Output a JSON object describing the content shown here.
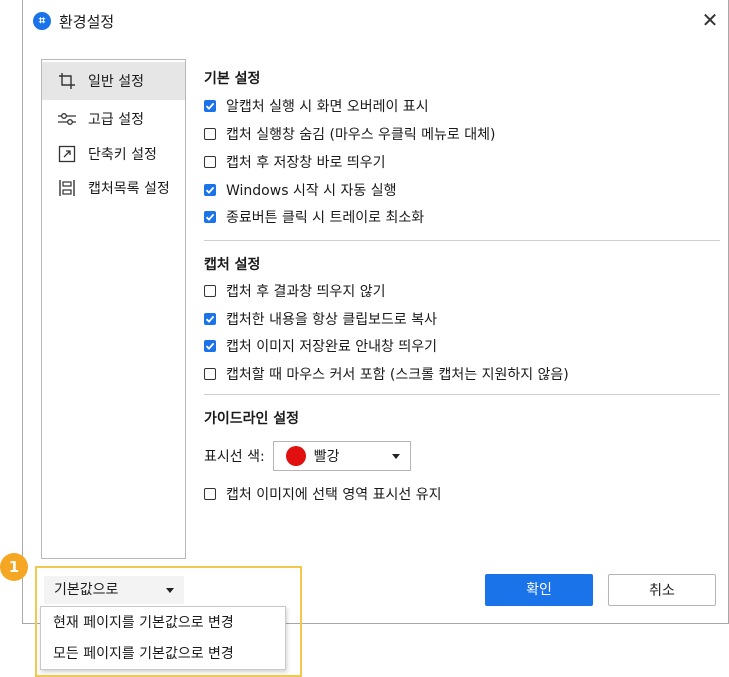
{
  "window": {
    "title": "환경설정",
    "app_icon": "capture-app-icon",
    "close_glyph": "✕"
  },
  "sidebar": {
    "items": [
      {
        "label": "일반 설정",
        "icon": "crop-icon",
        "active": true
      },
      {
        "label": "고급 설정",
        "icon": "sliders-icon",
        "active": false
      },
      {
        "label": "단축키 설정",
        "icon": "shortcut-arrow-icon",
        "active": false
      },
      {
        "label": "캡처목록 설정",
        "icon": "capture-list-icon",
        "active": false
      }
    ]
  },
  "basic": {
    "title": "기본 설정",
    "options": [
      {
        "label": "알캡처 실행 시 화면 오버레이 표시",
        "checked": true
      },
      {
        "label": "캡처 실행창 숨김 (마우스 우클릭 메뉴로 대체)",
        "checked": false
      },
      {
        "label": "캡처 후 저장창 바로 띄우기",
        "checked": false
      },
      {
        "label": "Windows 시작 시 자동 실행",
        "checked": true
      },
      {
        "label": "종료버튼 클릭 시 트레이로 최소화",
        "checked": true
      }
    ]
  },
  "capture": {
    "title": "캡처 설정",
    "options": [
      {
        "label": "캡처 후 결과창 띄우지 않기",
        "checked": false
      },
      {
        "label": "캡처한 내용을 항상 클립보드로 복사",
        "checked": true
      },
      {
        "label": "캡처 이미지 저장완료 안내창 띄우기",
        "checked": true
      },
      {
        "label": "캡처할 때 마우스 커서 포함 (스크롤 캡처는 지원하지 않음)",
        "checked": false
      }
    ]
  },
  "guide": {
    "title": "가이드라인 설정",
    "color_label": "표시선 색:",
    "color_value": "빨강",
    "color_hex": "#e01010",
    "keep_option": {
      "label": "캡처 이미지에 선택 영역 표시선 유지",
      "checked": false
    }
  },
  "footer": {
    "default_button": "기본값으로",
    "ok": "확인",
    "cancel": "취소",
    "menu": [
      "현재 페이지를 기본값으로 변경",
      "모든 페이지를 기본값으로 변경"
    ]
  },
  "annotation": {
    "badge": "1"
  },
  "colors": {
    "accent": "#1a73e8",
    "highlight": "#f2c94c",
    "badge": "#f5a623"
  }
}
